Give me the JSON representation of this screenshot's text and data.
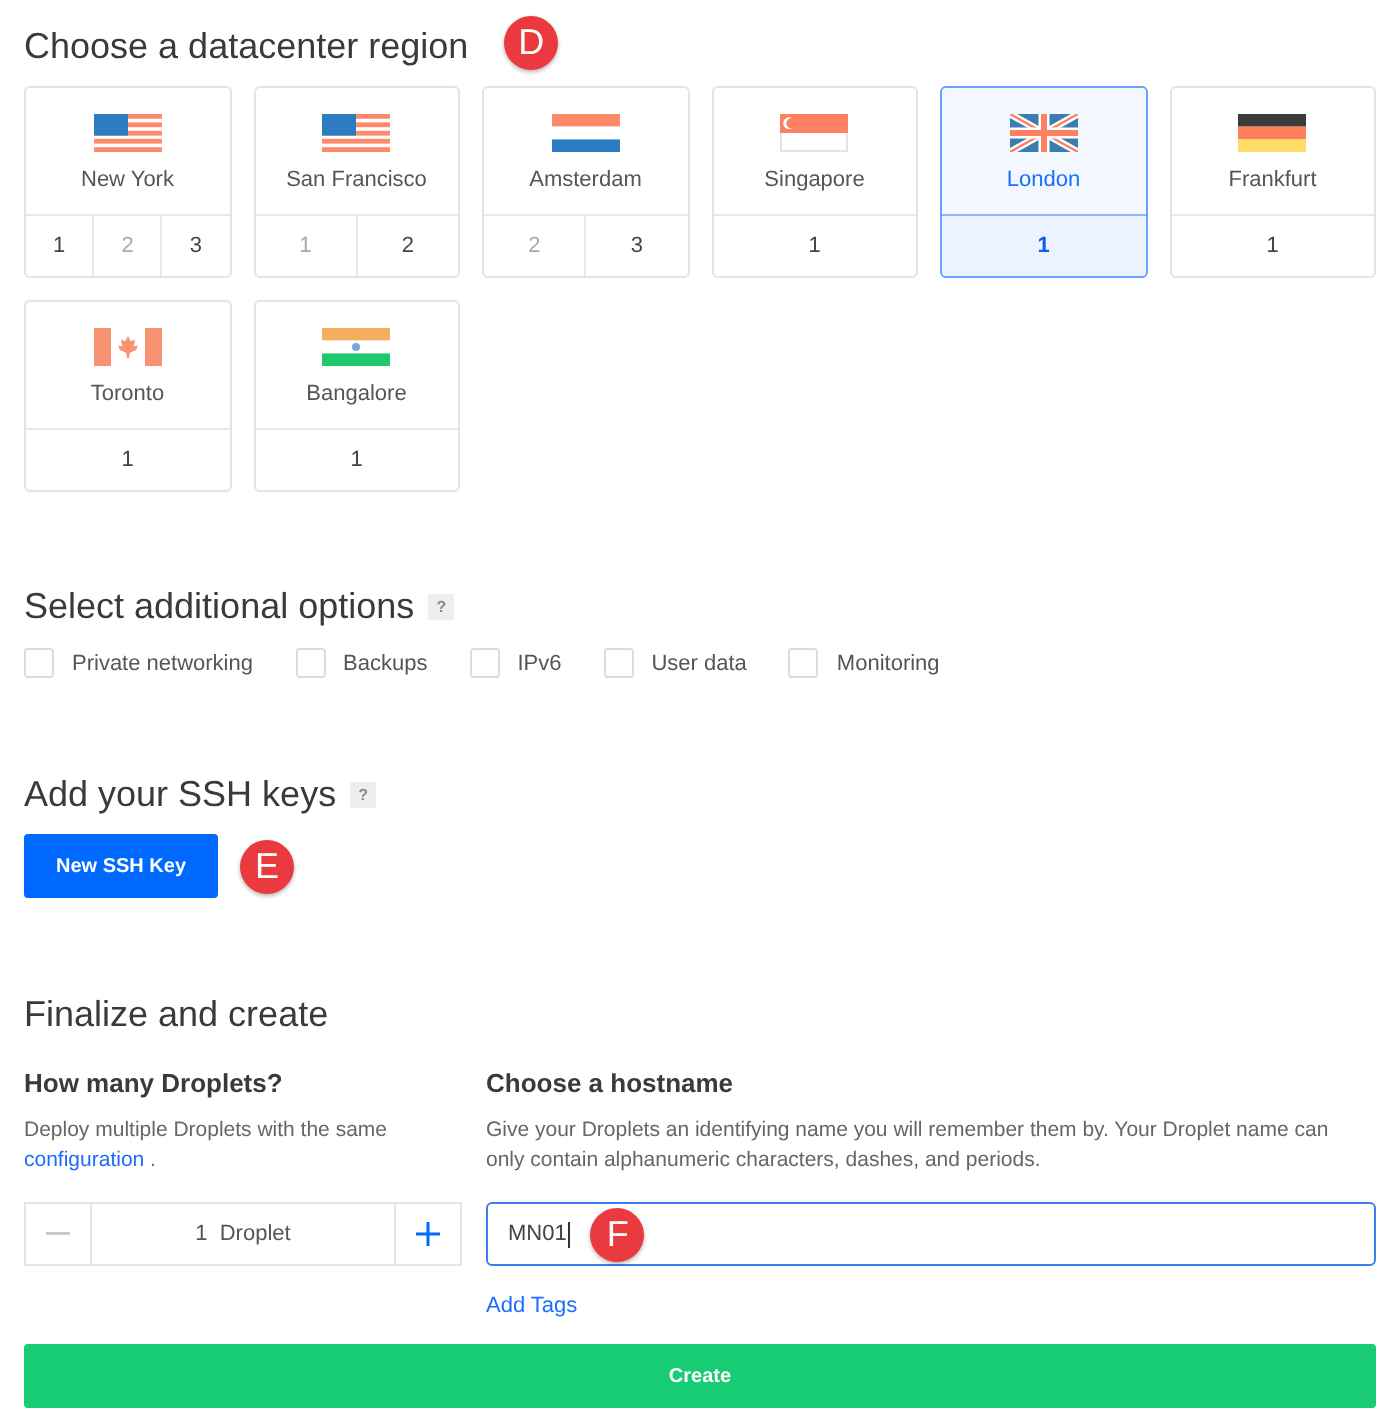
{
  "region_section": {
    "title": "Choose a datacenter region",
    "marker": "D",
    "regions": [
      {
        "name": "New York",
        "kind": "usa",
        "selected": false,
        "datacenters": [
          {
            "label": "1",
            "available": true,
            "selected": false
          },
          {
            "label": "2",
            "available": false,
            "selected": false
          },
          {
            "label": "3",
            "available": true,
            "selected": false
          }
        ]
      },
      {
        "name": "San Francisco",
        "kind": "usa",
        "selected": false,
        "datacenters": [
          {
            "label": "1",
            "available": false,
            "selected": false
          },
          {
            "label": "2",
            "available": true,
            "selected": false
          }
        ]
      },
      {
        "name": "Amsterdam",
        "kind": "netherlands",
        "selected": false,
        "datacenters": [
          {
            "label": "2",
            "available": false,
            "selected": false
          },
          {
            "label": "3",
            "available": true,
            "selected": false
          }
        ]
      },
      {
        "name": "Singapore",
        "kind": "singapore",
        "selected": false,
        "datacenters": [
          {
            "label": "1",
            "available": true,
            "selected": false
          }
        ]
      },
      {
        "name": "London",
        "kind": "uk",
        "selected": true,
        "datacenters": [
          {
            "label": "1",
            "available": true,
            "selected": true
          }
        ]
      },
      {
        "name": "Frankfurt",
        "kind": "germany",
        "selected": false,
        "datacenters": [
          {
            "label": "1",
            "available": true,
            "selected": false
          }
        ]
      },
      {
        "name": "Toronto",
        "kind": "canada",
        "selected": false,
        "datacenters": [
          {
            "label": "1",
            "available": true,
            "selected": false
          }
        ]
      },
      {
        "name": "Bangalore",
        "kind": "india",
        "selected": false,
        "datacenters": [
          {
            "label": "1",
            "available": true,
            "selected": false
          }
        ]
      }
    ]
  },
  "options_section": {
    "title": "Select additional options",
    "help": "?",
    "options": [
      {
        "label": "Private networking",
        "checked": false
      },
      {
        "label": "Backups",
        "checked": false
      },
      {
        "label": "IPv6",
        "checked": false
      },
      {
        "label": "User data",
        "checked": false
      },
      {
        "label": "Monitoring",
        "checked": false
      }
    ]
  },
  "ssh_section": {
    "title": "Add your SSH keys",
    "help": "?",
    "button": "New SSH Key",
    "marker": "E"
  },
  "finalize_section": {
    "title": "Finalize and create",
    "droplets": {
      "title": "How many Droplets?",
      "description": "Deploy multiple Droplets with the same",
      "link": "configuration",
      "after_link": ".",
      "count": "1 Droplet"
    },
    "hostname": {
      "title": "Choose a hostname",
      "description": "Give your Droplets an identifying name you will remember them by. Your Droplet name can only contain alphanumeric characters, dashes, and periods.",
      "value": "MN01",
      "marker": "F",
      "link": "Add Tags"
    },
    "create_button": "Create"
  }
}
